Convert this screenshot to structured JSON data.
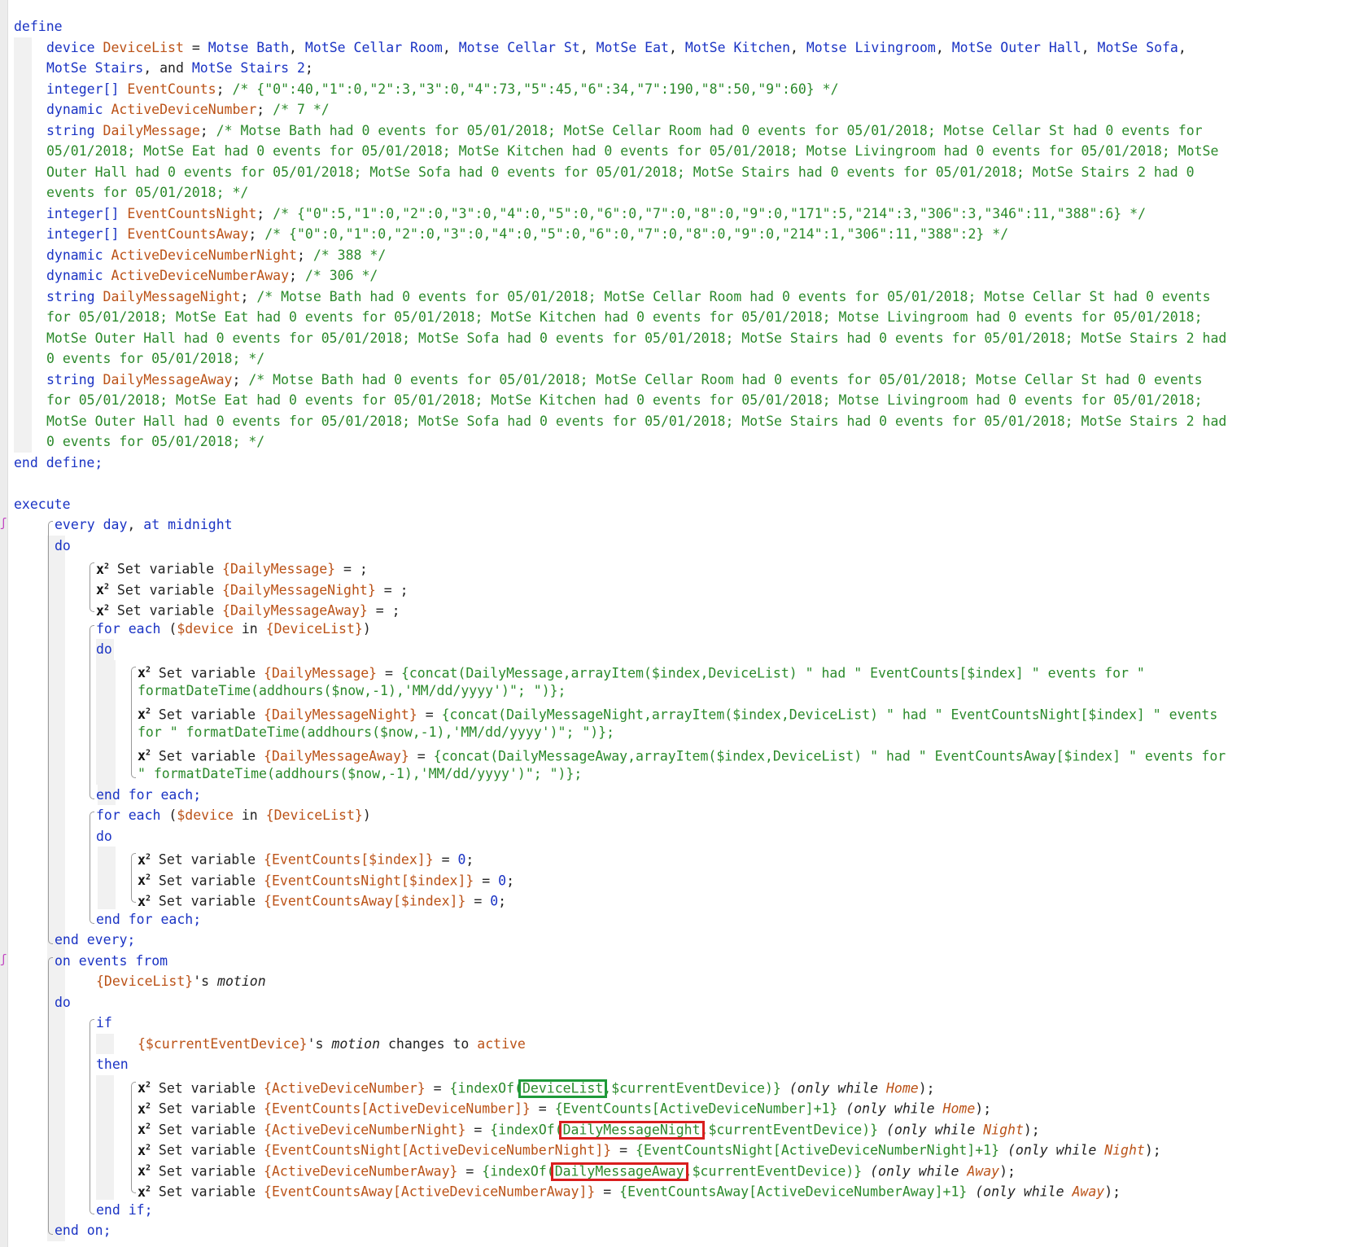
{
  "editor": {
    "highlights": {
      "green_label": "DeviceList",
      "red_labels": [
        "DailyMessageNight",
        "DailyMessageAway"
      ]
    },
    "lines": [
      [
        {
          "t": "define",
          "c": "kw"
        }
      ],
      [
        {
          "t": "device ",
          "c": "kw"
        },
        {
          "t": "DeviceList",
          "c": "var"
        },
        {
          "t": " = ",
          "c": "dark"
        },
        {
          "t": "Motse Bath",
          "c": "kw"
        },
        {
          "t": ", ",
          "c": "dark"
        },
        {
          "t": "MotSe Cellar Room",
          "c": "kw"
        },
        {
          "t": ", ",
          "c": "dark"
        },
        {
          "t": "Motse Cellar St",
          "c": "kw"
        },
        {
          "t": ", ",
          "c": "dark"
        },
        {
          "t": "MotSe Eat",
          "c": "kw"
        },
        {
          "t": ", ",
          "c": "dark"
        },
        {
          "t": "MotSe Kitchen",
          "c": "kw"
        },
        {
          "t": ", ",
          "c": "dark"
        },
        {
          "t": "Motse Livingroom",
          "c": "kw"
        },
        {
          "t": ", ",
          "c": "dark"
        },
        {
          "t": "MotSe Outer Hall",
          "c": "kw"
        },
        {
          "t": ", ",
          "c": "dark"
        },
        {
          "t": "MotSe Sofa",
          "c": "kw"
        },
        {
          "t": ",",
          "c": "dark"
        }
      ],
      [
        {
          "t": "MotSe Stairs",
          "c": "kw"
        },
        {
          "t": ", and ",
          "c": "dark"
        },
        {
          "t": "MotSe Stairs 2",
          "c": "kw"
        },
        {
          "t": ";",
          "c": "dark"
        }
      ],
      [
        {
          "t": "integer[] ",
          "c": "kw"
        },
        {
          "t": "EventCounts",
          "c": "var"
        },
        {
          "t": "; ",
          "c": "dark"
        },
        {
          "t": "/* {\"0\":40,\"1\":0,\"2\":3,\"3\":0,\"4\":73,\"5\":45,\"6\":34,\"7\":190,\"8\":50,\"9\":60} */",
          "c": "cmt"
        }
      ],
      [
        {
          "t": "dynamic ",
          "c": "kw"
        },
        {
          "t": "ActiveDeviceNumber",
          "c": "var"
        },
        {
          "t": "; ",
          "c": "dark"
        },
        {
          "t": "/* 7 */",
          "c": "cmt"
        }
      ],
      [
        {
          "t": "string ",
          "c": "kw"
        },
        {
          "t": "DailyMessage",
          "c": "var"
        },
        {
          "t": "; ",
          "c": "dark"
        },
        {
          "t": "/* Motse Bath had 0 events for 05/01/2018; MotSe Cellar Room had 0 events for 05/01/2018; Motse Cellar St had 0 events for",
          "c": "cmt"
        }
      ],
      [
        {
          "t": "05/01/2018; MotSe Eat had 0 events for 05/01/2018; MotSe Kitchen had 0 events for 05/01/2018; Motse Livingroom had 0 events for 05/01/2018; MotSe",
          "c": "cmt"
        }
      ],
      [
        {
          "t": "Outer Hall had 0 events for 05/01/2018; MotSe Sofa had 0 events for 05/01/2018; MotSe Stairs had 0 events for 05/01/2018; MotSe Stairs 2 had 0",
          "c": "cmt"
        }
      ],
      [
        {
          "t": "events for 05/01/2018; */",
          "c": "cmt"
        }
      ],
      [
        {
          "t": "integer[] ",
          "c": "kw"
        },
        {
          "t": "EventCountsNight",
          "c": "var"
        },
        {
          "t": "; ",
          "c": "dark"
        },
        {
          "t": "/* {\"0\":5,\"1\":0,\"2\":0,\"3\":0,\"4\":0,\"5\":0,\"6\":0,\"7\":0,\"8\":0,\"9\":0,\"171\":5,\"214\":3,\"306\":3,\"346\":11,\"388\":6} */",
          "c": "cmt"
        }
      ],
      [
        {
          "t": "integer[] ",
          "c": "kw"
        },
        {
          "t": "EventCountsAway",
          "c": "var"
        },
        {
          "t": "; ",
          "c": "dark"
        },
        {
          "t": "/* {\"0\":0,\"1\":0,\"2\":0,\"3\":0,\"4\":0,\"5\":0,\"6\":0,\"7\":0,\"8\":0,\"9\":0,\"214\":1,\"306\":11,\"388\":2} */",
          "c": "cmt"
        }
      ],
      [
        {
          "t": "dynamic ",
          "c": "kw"
        },
        {
          "t": "ActiveDeviceNumberNight",
          "c": "var"
        },
        {
          "t": "; ",
          "c": "dark"
        },
        {
          "t": "/* 388 */",
          "c": "cmt"
        }
      ],
      [
        {
          "t": "dynamic ",
          "c": "kw"
        },
        {
          "t": "ActiveDeviceNumberAway",
          "c": "var"
        },
        {
          "t": "; ",
          "c": "dark"
        },
        {
          "t": "/* 306 */",
          "c": "cmt"
        }
      ],
      [
        {
          "t": "string ",
          "c": "kw"
        },
        {
          "t": "DailyMessageNight",
          "c": "var"
        },
        {
          "t": "; ",
          "c": "dark"
        },
        {
          "t": "/* Motse Bath had 0 events for 05/01/2018; MotSe Cellar Room had 0 events for 05/01/2018; Motse Cellar St had 0 events",
          "c": "cmt"
        }
      ],
      [
        {
          "t": "for 05/01/2018; MotSe Eat had 0 events for 05/01/2018; MotSe Kitchen had 0 events for 05/01/2018; Motse Livingroom had 0 events for 05/01/2018;",
          "c": "cmt"
        }
      ],
      [
        {
          "t": "MotSe Outer Hall had 0 events for 05/01/2018; MotSe Sofa had 0 events for 05/01/2018; MotSe Stairs had 0 events for 05/01/2018; MotSe Stairs 2 had",
          "c": "cmt"
        }
      ],
      [
        {
          "t": "0 events for 05/01/2018; */",
          "c": "cmt"
        }
      ],
      [
        {
          "t": "string ",
          "c": "kw"
        },
        {
          "t": "DailyMessageAway",
          "c": "var"
        },
        {
          "t": "; ",
          "c": "dark"
        },
        {
          "t": "/* Motse Bath had 0 events for 05/01/2018; MotSe Cellar Room had 0 events for 05/01/2018; Motse Cellar St had 0 events",
          "c": "cmt"
        }
      ],
      [
        {
          "t": "for 05/01/2018; MotSe Eat had 0 events for 05/01/2018; MotSe Kitchen had 0 events for 05/01/2018; Motse Livingroom had 0 events for 05/01/2018;",
          "c": "cmt"
        }
      ],
      [
        {
          "t": "MotSe Outer Hall had 0 events for 05/01/2018; MotSe Sofa had 0 events for 05/01/2018; MotSe Stairs had 0 events for 05/01/2018; MotSe Stairs 2 had",
          "c": "cmt"
        }
      ],
      [
        {
          "t": "0 events for 05/01/2018; */",
          "c": "cmt"
        }
      ],
      [
        {
          "t": "end define;",
          "c": "kw"
        }
      ],
      [],
      [
        {
          "t": "execute",
          "c": "kw"
        }
      ],
      [
        {
          "t": "every day",
          "c": "kw"
        },
        {
          "t": ", ",
          "c": "dark"
        },
        {
          "t": "at ",
          "c": "kw"
        },
        {
          "t": "midnight",
          "c": "kw"
        }
      ],
      [
        {
          "t": "do",
          "c": "kw"
        }
      ],
      [
        {
          "t": "x²",
          "c": "x2"
        },
        {
          "t": " Set variable ",
          "c": "dark"
        },
        {
          "t": "{DailyMessage}",
          "c": "var"
        },
        {
          "t": " = ;",
          "c": "dark"
        }
      ],
      [
        {
          "t": "x²",
          "c": "x2"
        },
        {
          "t": " Set variable ",
          "c": "dark"
        },
        {
          "t": "{DailyMessageNight}",
          "c": "var"
        },
        {
          "t": " = ;",
          "c": "dark"
        }
      ],
      [
        {
          "t": "x²",
          "c": "x2"
        },
        {
          "t": " Set variable ",
          "c": "dark"
        },
        {
          "t": "{DailyMessageAway}",
          "c": "var"
        },
        {
          "t": " = ;",
          "c": "dark"
        }
      ],
      [
        {
          "t": "for each ",
          "c": "kw"
        },
        {
          "t": "(",
          "c": "dark"
        },
        {
          "t": "$device",
          "c": "var"
        },
        {
          "t": " in ",
          "c": "dark"
        },
        {
          "t": "{DeviceList}",
          "c": "var"
        },
        {
          "t": ")",
          "c": "dark"
        }
      ],
      [
        {
          "t": "do",
          "c": "kw"
        }
      ],
      [
        {
          "t": "x²",
          "c": "x2"
        },
        {
          "t": " Set variable ",
          "c": "dark"
        },
        {
          "t": "{DailyMessage}",
          "c": "var"
        },
        {
          "t": " = ",
          "c": "dark"
        },
        {
          "t": "{concat(DailyMessage,arrayItem($index,DeviceList) \" had \" EventCounts[$index] \" events for \"",
          "c": "str"
        }
      ],
      [
        {
          "t": "formatDateTime(addhours($now,-1),'MM/dd/yyyy')\"; \")};",
          "c": "str"
        }
      ],
      [
        {
          "t": "x²",
          "c": "x2"
        },
        {
          "t": " Set variable ",
          "c": "dark"
        },
        {
          "t": "{DailyMessageNight}",
          "c": "var"
        },
        {
          "t": " = ",
          "c": "dark"
        },
        {
          "t": "{concat(DailyMessageNight,arrayItem($index,DeviceList) \" had \" EventCountsNight[$index] \" events",
          "c": "str"
        }
      ],
      [
        {
          "t": "for \" formatDateTime(addhours($now,-1),'MM/dd/yyyy')\"; \")};",
          "c": "str"
        }
      ],
      [
        {
          "t": "x²",
          "c": "x2"
        },
        {
          "t": " Set variable ",
          "c": "dark"
        },
        {
          "t": "{DailyMessageAway}",
          "c": "var"
        },
        {
          "t": " = ",
          "c": "dark"
        },
        {
          "t": "{concat(DailyMessageAway,arrayItem($index,DeviceList) \" had \" EventCountsAway[$index] \" events for",
          "c": "str"
        }
      ],
      [
        {
          "t": "\" formatDateTime(addhours($now,-1),'MM/dd/yyyy')\"; \")};",
          "c": "str"
        }
      ],
      [
        {
          "t": "end for each;",
          "c": "kw"
        }
      ],
      [
        {
          "t": "for each ",
          "c": "kw"
        },
        {
          "t": "(",
          "c": "dark"
        },
        {
          "t": "$device",
          "c": "var"
        },
        {
          "t": " in ",
          "c": "dark"
        },
        {
          "t": "{DeviceList}",
          "c": "var"
        },
        {
          "t": ")",
          "c": "dark"
        }
      ],
      [
        {
          "t": "do",
          "c": "kw"
        }
      ],
      [
        {
          "t": "x²",
          "c": "x2"
        },
        {
          "t": " Set variable ",
          "c": "dark"
        },
        {
          "t": "{EventCounts[$index]}",
          "c": "var"
        },
        {
          "t": " = ",
          "c": "dark"
        },
        {
          "t": "0",
          "c": "kw"
        },
        {
          "t": ";",
          "c": "dark"
        }
      ],
      [
        {
          "t": "x²",
          "c": "x2"
        },
        {
          "t": " Set variable ",
          "c": "dark"
        },
        {
          "t": "{EventCountsNight[$index]}",
          "c": "var"
        },
        {
          "t": " = ",
          "c": "dark"
        },
        {
          "t": "0",
          "c": "kw"
        },
        {
          "t": ";",
          "c": "dark"
        }
      ],
      [
        {
          "t": "x²",
          "c": "x2"
        },
        {
          "t": " Set variable ",
          "c": "dark"
        },
        {
          "t": "{EventCountsAway[$index]}",
          "c": "var"
        },
        {
          "t": " = ",
          "c": "dark"
        },
        {
          "t": "0",
          "c": "kw"
        },
        {
          "t": ";",
          "c": "dark"
        }
      ],
      [
        {
          "t": "end for each;",
          "c": "kw"
        }
      ],
      [
        {
          "t": "end every;",
          "c": "kw"
        }
      ],
      [
        {
          "t": "on events from",
          "c": "kw"
        }
      ],
      [
        {
          "t": "{DeviceList}",
          "c": "var"
        },
        {
          "t": "'s ",
          "c": "dark"
        },
        {
          "t": "motion",
          "c": "dark ital"
        }
      ],
      [
        {
          "t": "do",
          "c": "kw"
        }
      ],
      [
        {
          "t": "if",
          "c": "kw"
        }
      ],
      [
        {
          "t": "{$currentEventDevice}",
          "c": "var"
        },
        {
          "t": "'s ",
          "c": "dark"
        },
        {
          "t": "motion",
          "c": "dark ital"
        },
        {
          "t": " changes to ",
          "c": "dark"
        },
        {
          "t": "active",
          "c": "var"
        }
      ],
      [
        {
          "t": "then",
          "c": "kw"
        }
      ],
      [
        {
          "t": "x²",
          "c": "x2"
        },
        {
          "t": " Set variable ",
          "c": "dark"
        },
        {
          "t": "{ActiveDeviceNumber}",
          "c": "var"
        },
        {
          "t": " = ",
          "c": "dark"
        },
        {
          "t": "{indexOf(",
          "c": "str"
        },
        {
          "t": "DeviceList",
          "c": "str",
          "hl": "green"
        },
        {
          "t": ",$currentEventDevice)}",
          "c": "str"
        },
        {
          "t": " (only while ",
          "c": "dark ital"
        },
        {
          "t": "Home",
          "c": "var ital"
        },
        {
          "t": ");",
          "c": "dark"
        }
      ],
      [
        {
          "t": "x²",
          "c": "x2"
        },
        {
          "t": " Set variable ",
          "c": "dark"
        },
        {
          "t": "{EventCounts[ActiveDeviceNumber]}",
          "c": "var"
        },
        {
          "t": " = ",
          "c": "dark"
        },
        {
          "t": "{EventCounts[ActiveDeviceNumber]+1}",
          "c": "str"
        },
        {
          "t": " (only while ",
          "c": "dark ital"
        },
        {
          "t": "Home",
          "c": "var ital"
        },
        {
          "t": ");",
          "c": "dark"
        }
      ],
      [
        {
          "t": "x²",
          "c": "x2"
        },
        {
          "t": " Set variable ",
          "c": "dark"
        },
        {
          "t": "{ActiveDeviceNumberNight}",
          "c": "var"
        },
        {
          "t": " = ",
          "c": "dark"
        },
        {
          "t": "{indexOf(",
          "c": "str"
        },
        {
          "t": "DailyMessageNight",
          "c": "str",
          "hl": "red"
        },
        {
          "t": ",$currentEventDevice)}",
          "c": "str"
        },
        {
          "t": " (only while ",
          "c": "dark ital"
        },
        {
          "t": "Night",
          "c": "var ital"
        },
        {
          "t": ");",
          "c": "dark"
        }
      ],
      [
        {
          "t": "x²",
          "c": "x2"
        },
        {
          "t": " Set variable ",
          "c": "dark"
        },
        {
          "t": "{EventCountsNight[ActiveDeviceNumberNight]}",
          "c": "var"
        },
        {
          "t": " = ",
          "c": "dark"
        },
        {
          "t": "{EventCountsNight[ActiveDeviceNumberNight]+1}",
          "c": "str"
        },
        {
          "t": " (only while ",
          "c": "dark ital"
        },
        {
          "t": "Night",
          "c": "var ital"
        },
        {
          "t": ");",
          "c": "dark"
        }
      ],
      [
        {
          "t": "x²",
          "c": "x2"
        },
        {
          "t": " Set variable ",
          "c": "dark"
        },
        {
          "t": "{ActiveDeviceNumberAway}",
          "c": "var"
        },
        {
          "t": " = ",
          "c": "dark"
        },
        {
          "t": "{indexOf(",
          "c": "str"
        },
        {
          "t": "DailyMessageAway",
          "c": "str",
          "hl": "red"
        },
        {
          "t": ",$currentEventDevice)}",
          "c": "str"
        },
        {
          "t": " (only while ",
          "c": "dark ital"
        },
        {
          "t": "Away",
          "c": "var ital"
        },
        {
          "t": ");",
          "c": "dark"
        }
      ],
      [
        {
          "t": "x²",
          "c": "x2"
        },
        {
          "t": " Set variable ",
          "c": "dark"
        },
        {
          "t": "{EventCountsAway[ActiveDeviceNumberAway]}",
          "c": "var"
        },
        {
          "t": " = ",
          "c": "dark"
        },
        {
          "t": "{EventCountsAway[ActiveDeviceNumberAway]+1}",
          "c": "str"
        },
        {
          "t": " (only while ",
          "c": "dark ital"
        },
        {
          "t": "Away",
          "c": "var ital"
        },
        {
          "t": ");",
          "c": "dark"
        }
      ],
      [
        {
          "t": "end if;",
          "c": "kw"
        }
      ],
      [
        {
          "t": "end on;",
          "c": "kw"
        }
      ]
    ]
  }
}
